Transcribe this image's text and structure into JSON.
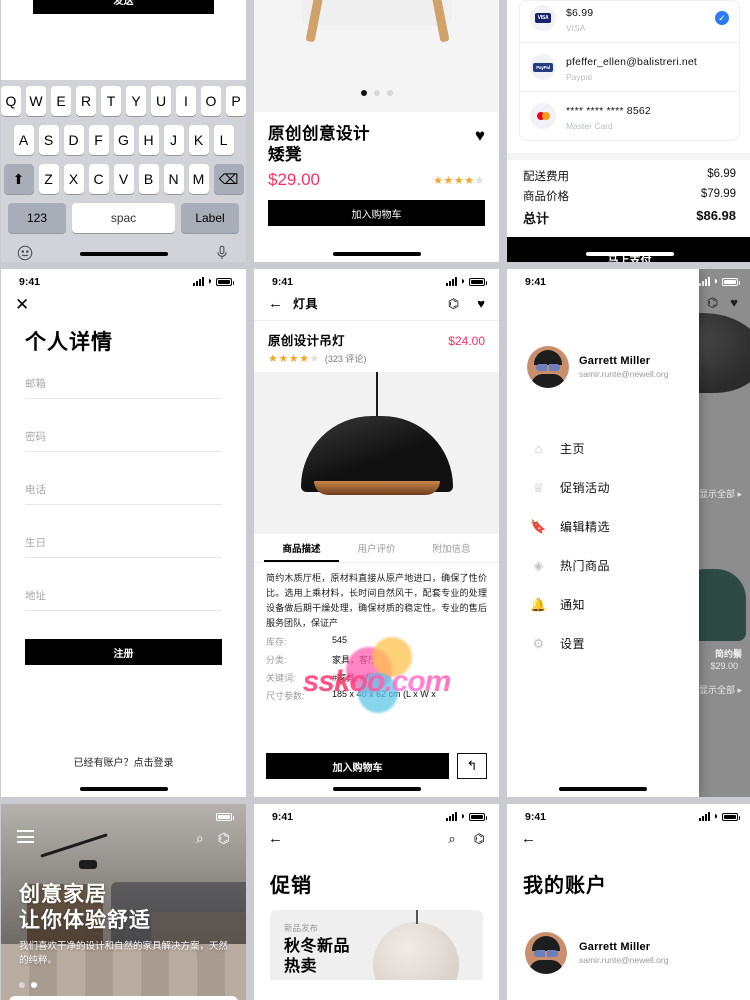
{
  "status_bar": {
    "time": "9:41"
  },
  "p1_keyboard": {
    "send_label": "发送",
    "rows": [
      [
        "Q",
        "W",
        "E",
        "R",
        "T",
        "Y",
        "U",
        "I",
        "O",
        "P"
      ],
      [
        "A",
        "S",
        "D",
        "F",
        "G",
        "H",
        "J",
        "K",
        "L"
      ],
      [
        "⬆",
        "Z",
        "X",
        "C",
        "V",
        "B",
        "N",
        "M",
        "⌫"
      ]
    ],
    "numeric_label": "123",
    "space_label": "spac",
    "label_key": "Label",
    "emoji_icon": "emoji-icon",
    "mic_icon": "microphone-icon"
  },
  "p2_product": {
    "title": "原创创意设计\n矮凳",
    "title_line1": "原创创意设计",
    "title_line2": "矮凳",
    "price": "$29.00",
    "rating": 4,
    "rating_max": 5,
    "stars": "★★★★",
    "star_off": "★",
    "cta": "加入购物车",
    "favorite_icon": "heart-icon",
    "carousel_dots": 3,
    "carousel_active": 0
  },
  "p3_payment": {
    "methods": [
      {
        "number": "$6.99",
        "label": "VISA",
        "logo": "visa-logo",
        "selected": true
      },
      {
        "number": "pfeffer_ellen@balistreri.net",
        "label": "Paypal",
        "logo": "paypal-logo",
        "selected": false
      },
      {
        "number": "**** **** **** 8562",
        "label": "Master Card",
        "logo": "mastercard-logo",
        "selected": false
      }
    ],
    "totals": [
      {
        "label": "配送费用",
        "value": "$6.99"
      },
      {
        "label": "商品价格",
        "value": "$79.99"
      }
    ],
    "grand_label": "总计",
    "grand_value": "$86.98",
    "pay_button": "马上支付"
  },
  "p4_signup": {
    "close_icon": "close-icon",
    "title": "个人详情",
    "fields": [
      {
        "placeholder": "邮箱",
        "value": ""
      },
      {
        "placeholder": "密码",
        "value": ""
      },
      {
        "placeholder": "电话",
        "value": ""
      },
      {
        "placeholder": "生日",
        "value": ""
      },
      {
        "placeholder": "地址",
        "value": ""
      }
    ],
    "submit": "注册",
    "login_hint": "已经有账户？点击登录"
  },
  "p5_lamp": {
    "nav_title": "灯具",
    "back_icon": "back-arrow-icon",
    "bag_icon": "shopping-bag-icon",
    "heart_icon": "heart-icon",
    "name": "原创设计吊灯",
    "price": "$24.00",
    "stars": "★★★★",
    "star_off": "★",
    "reviews": "(323 评论)",
    "tabs": [
      {
        "label": "商品描述",
        "active": true
      },
      {
        "label": "用户评价",
        "active": false
      },
      {
        "label": "附加信息",
        "active": false
      }
    ],
    "description": "简约木质厅柜，原材料直接从原产地进口，确保了性价比。选用上乘材料，长时间自然风干，配套专业的处理设备做后期干燥处理，确保材质的稳定性。专业的售后服务团队，保证产",
    "specs": [
      {
        "key": "库存:",
        "value": "545"
      },
      {
        "key": "分类:",
        "value": "家具，客厅"
      },
      {
        "key": "关键词:",
        "value": "#家具, #柜子"
      },
      {
        "key": "尺寸参数:",
        "value": "185 x 40 x 62 cm (L x W x"
      }
    ],
    "cta": "加入购物车",
    "share_icon": "reply-arrow-icon",
    "watermark": "sskoo.com"
  },
  "p6_drawer": {
    "user_name": "Garrett Miller",
    "user_email": "samir.runte@newell.org",
    "avatar_icon": "avatar",
    "items": [
      {
        "label": "主页",
        "icon": "home-icon"
      },
      {
        "label": "促销活动",
        "icon": "crown-icon"
      },
      {
        "label": "编辑精选",
        "icon": "bookmark-icon"
      },
      {
        "label": "热门商品",
        "icon": "tag-icon"
      },
      {
        "label": "通知",
        "icon": "bell-icon"
      },
      {
        "label": "设置",
        "icon": "gear-icon"
      }
    ],
    "background": {
      "bag_icon": "shopping-bag-icon",
      "heart_icon": "heart-icon",
      "show_all_1": "显示全部 ▸",
      "show_all_2": "显示全部 ▸",
      "product_name": "简约鬃",
      "product_price": "$29.00"
    }
  },
  "p7_home": {
    "menu_icon": "hamburger-menu-icon",
    "search_icon": "search-icon",
    "bag_icon": "shopping-bag-icon",
    "heading_line1": "创意家居",
    "heading_line2": "让你体验舒适",
    "subtitle": "我们喜欢干净的设计和自然的家具解决方案，天然的纯粹。",
    "dots": 2,
    "dot_active": 1
  },
  "p8_promotions": {
    "back_icon": "back-arrow-icon",
    "search_icon": "search-icon",
    "bag_icon": "shopping-bag-icon",
    "title": "促销",
    "card_kicker": "新品发布",
    "card_line1": "秋冬新品",
    "card_line2": "热卖"
  },
  "p9_account": {
    "back_icon": "back-arrow-icon",
    "title": "我的账户",
    "user_name": "Garrett Miller",
    "user_email": "samir.runte@newell.org"
  },
  "colors": {
    "accent_price": "#ff2e63",
    "star": "#f5a623",
    "black": "#000000",
    "keyboard_bg": "#d1d3d9",
    "check_blue": "#2f7bf6"
  }
}
